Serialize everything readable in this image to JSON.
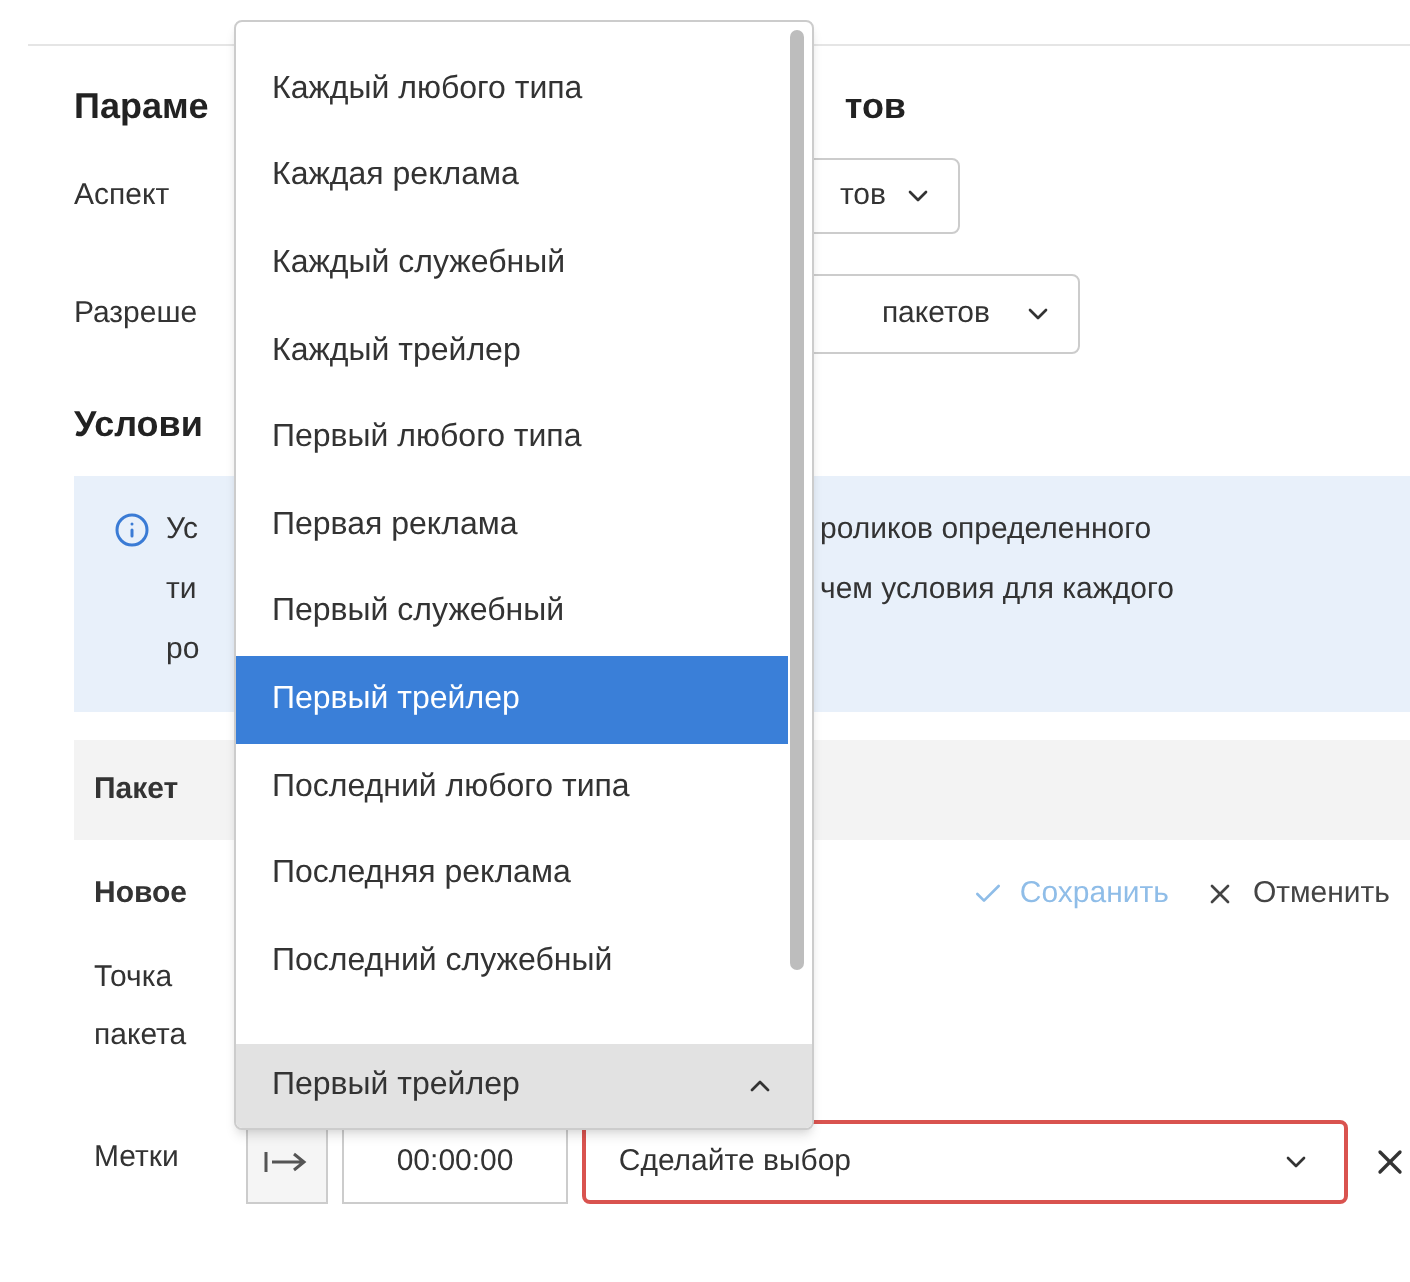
{
  "section_heading": {
    "left": "Параме",
    "right": "тов"
  },
  "aspect": {
    "label": "Аспект",
    "value": "тов"
  },
  "permission": {
    "label": "Разреше",
    "value": "пакетов"
  },
  "conditions_heading": "Услови",
  "info": {
    "left_lines": [
      "Ус",
      "ти",
      "ро"
    ],
    "right_lines": [
      "роликов определенного",
      "чем условия для каждого"
    ]
  },
  "table": {
    "column_1": "Пакет"
  },
  "new_row": {
    "label": "Новое",
    "save": "Сохранить",
    "cancel": "Отменить"
  },
  "point_label": "Точка пакета",
  "marks": {
    "label": "Метки",
    "time": "00:00:00",
    "select_placeholder": "Сделайте выбор"
  },
  "dropdown": {
    "value": "Первый трейлер",
    "expanded": true,
    "options": [
      {
        "label": "Каждый любого типа",
        "selected": false
      },
      {
        "label": "Каждая реклама",
        "selected": false
      },
      {
        "label": "Каждый служебный",
        "selected": false
      },
      {
        "label": "Каждый трейлер",
        "selected": false
      },
      {
        "label": "Первый любого типа",
        "selected": false
      },
      {
        "label": "Первая реклама",
        "selected": false
      },
      {
        "label": "Первый служебный",
        "selected": false
      },
      {
        "label": "Первый трейлер",
        "selected": true
      },
      {
        "label": "Последний любого типа",
        "selected": false
      },
      {
        "label": "Последняя реклама",
        "selected": false
      },
      {
        "label": "Последний служебный",
        "selected": false
      }
    ]
  }
}
